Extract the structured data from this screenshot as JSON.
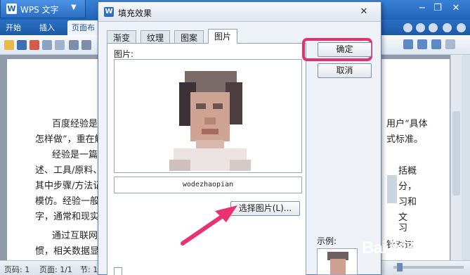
{
  "app": {
    "logo_letter": "W",
    "name": "WPS 文字",
    "caret": "▼",
    "minimize": "−",
    "restore": "❐",
    "close": "✕"
  },
  "menu": {
    "items": [
      "开始",
      "插入",
      "页面布"
    ]
  },
  "document": {
    "lines": [
      {
        "left": "百度经验是",
        "right": "用户“具体"
      },
      {
        "left": "怎样做”，重在解",
        "right": "式标准。"
      },
      {
        "left": "经验是一篇",
        "right": "括概"
      },
      {
        "left": "述、工具/原料、",
        "right": "分，"
      },
      {
        "left": "其中步骤/方法记",
        "right": "习和"
      },
      {
        "left": "模仿。经验一般",
        "right": "文"
      },
      {
        "left": "字，通常和现实",
        "right": ""
      },
      {
        "left": "通过互联网",
        "right": "习"
      },
      {
        "left": "惯，相关数据显",
        "right": "针对这"
      }
    ]
  },
  "status": {
    "page_code": "页码: 1",
    "page": "页面: 1/1",
    "section": "节: 1"
  },
  "dialog": {
    "logo_letter": "W",
    "title": "填充效果",
    "close": "✕",
    "tabs": [
      "渐变",
      "纹理",
      "图案",
      "图片"
    ],
    "active_tab": 3,
    "picture_label": "图片:",
    "filename": "wodezhaopian",
    "select_button": "选择图片(L)...",
    "ok_button": "确定",
    "cancel_button": "取消",
    "example_label": "示例:"
  },
  "watermark": {
    "text": "Bai 经验",
    "sub": "jingyan.baidu.com"
  },
  "colors": {
    "highlight": "#e0326f",
    "arrow": "#e8336f"
  }
}
